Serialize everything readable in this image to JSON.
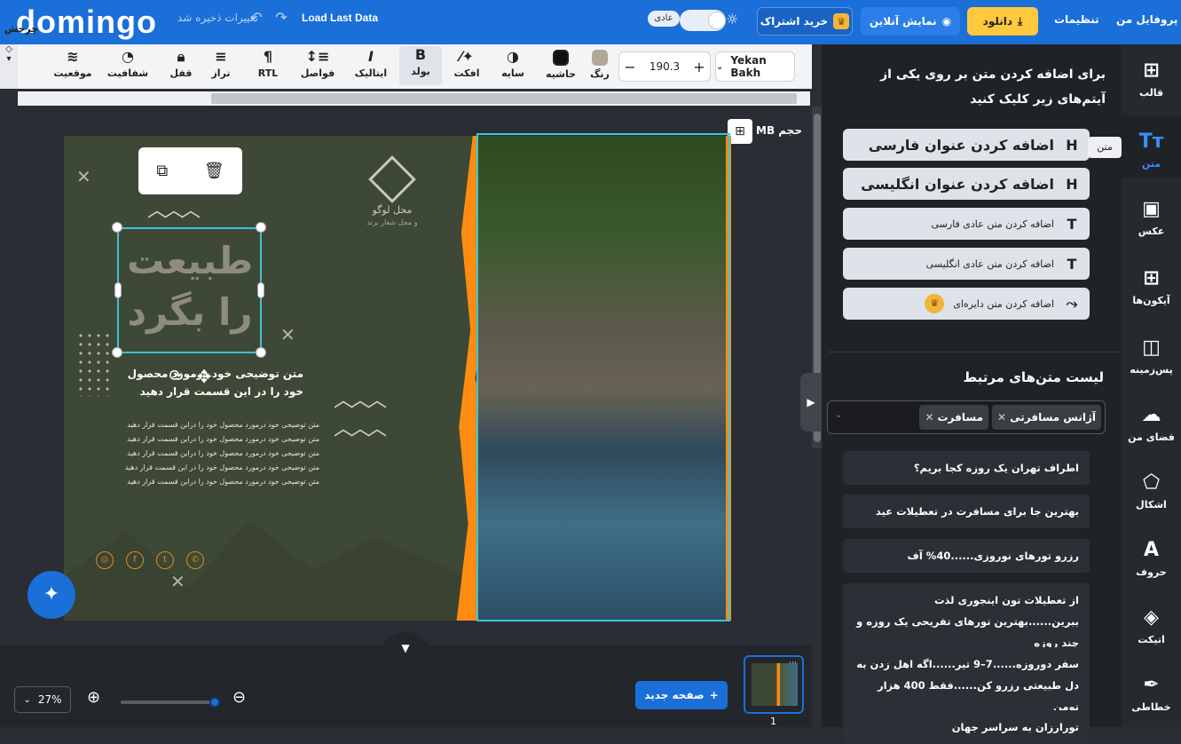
{
  "topbar": {
    "logo": "domingo",
    "unsaved_text": "تغییرات ذخیره شد",
    "load_last": "Load Last Data",
    "mode_label": "عادی",
    "subscribe_label": "خرید اشتراک",
    "online_preview_label": "نمایش آنلاین",
    "download_label": "دانلود",
    "settings_label": "تنظیمات",
    "profile_label": "پروفایل من"
  },
  "toolbar": {
    "rotate_label": "چرخش",
    "position_label": "موقعیت",
    "transparency_label": "شفافیت",
    "lock_label": "قفل",
    "align_label": "تراز",
    "rtl_label": "RTL",
    "spacing_label": "فواصل",
    "italic_label": "ایتالیک",
    "bold_label": "بولد",
    "effect_label": "افکت",
    "shadow_label": "سایه",
    "border_label": "حاشیه",
    "color_label": "رنگ",
    "font_size": "190.3",
    "font_name": "Yekan Bakh",
    "colors": {
      "text": "#b3a898",
      "border": "#111111"
    }
  },
  "canvas": {
    "size_label": "حجم MB",
    "logo_title": "محل لوگو",
    "logo_sub": "و محل شعار برند",
    "big_title_line1": "طبیعت",
    "big_title_line2": "را بگرد",
    "desc_bold": "متن توضیحی خود درمورد محصول خود را در این قسمت قرار دهید",
    "desc_small": "متن توضیحی خود درمورد محصول خود را دراین قسمت قرار دهید متن توضیحی خود درمورد محصول خود را دراین قسمت قرار دهید متن توضیحی خود درمورد محصول خود را دراین قسمت قرار دهید متن توضیحی خود درمورد محصول خود را در این قسمت قرار دهید متن توضیحی خود درمورد محصول خود را دراین قسمت قرار دهید"
  },
  "bottom": {
    "zoom": "27%",
    "new_page_label": "صفحه جدید",
    "page_number": "1"
  },
  "panel": {
    "title": "برای اضافه کردن متن بر روی یکی از آیتم‌های زیر کلیک کنید",
    "tooltip": "متن",
    "add_items": [
      {
        "label": "اضافه کردن عنوان فارسی",
        "icon": "H"
      },
      {
        "label": "اضافه کردن عنوان انگلیسی",
        "icon": "H"
      },
      {
        "label": "اضافه کردن متن عادی فارسی",
        "icon": "T"
      },
      {
        "label": "اضافه کردن متن عادی انگلیسی",
        "icon": "T"
      },
      {
        "label": "اضافه کردن متن دایره‌ای",
        "icon": "curve-text-icon"
      }
    ],
    "related_title": "لیست متن‌های مرتبط",
    "tags": [
      "آژانس مسافرتی",
      "مسافرت"
    ],
    "related_items": [
      "اطراف تهران یک روزه کجا بریم؟",
      "بهترین جا برای مسافرت در تعطیلات عید",
      "رزرو تورهای نوروزی......40% آف",
      "از تعطیلات تون اینجوری لذت ببرین......بهترین تورهای تفریحی یک روزه و چند روزه",
      "سفر دوروزه......7–9 تیر......اگه اهل زدن به دل طبیعتی رزرو کن......فقط 400 هزار تومن",
      "تورارزان به سراسر جهان"
    ]
  },
  "sidebar": {
    "items": [
      {
        "label": "قالب",
        "icon": "template-icon"
      },
      {
        "label": "متن",
        "icon": "text-icon"
      },
      {
        "label": "عکس",
        "icon": "image-icon"
      },
      {
        "label": "آیکون‌ها",
        "icon": "icons-icon"
      },
      {
        "label": "پس‌زمینه",
        "icon": "background-icon"
      },
      {
        "label": "فضای من",
        "icon": "upload-icon"
      },
      {
        "label": "اشکال",
        "icon": "shapes-icon"
      },
      {
        "label": "حروف",
        "icon": "letters-icon"
      },
      {
        "label": "اتیکت",
        "icon": "sticker-icon"
      },
      {
        "label": "خطاطی",
        "icon": "calligraphy-icon"
      }
    ]
  }
}
